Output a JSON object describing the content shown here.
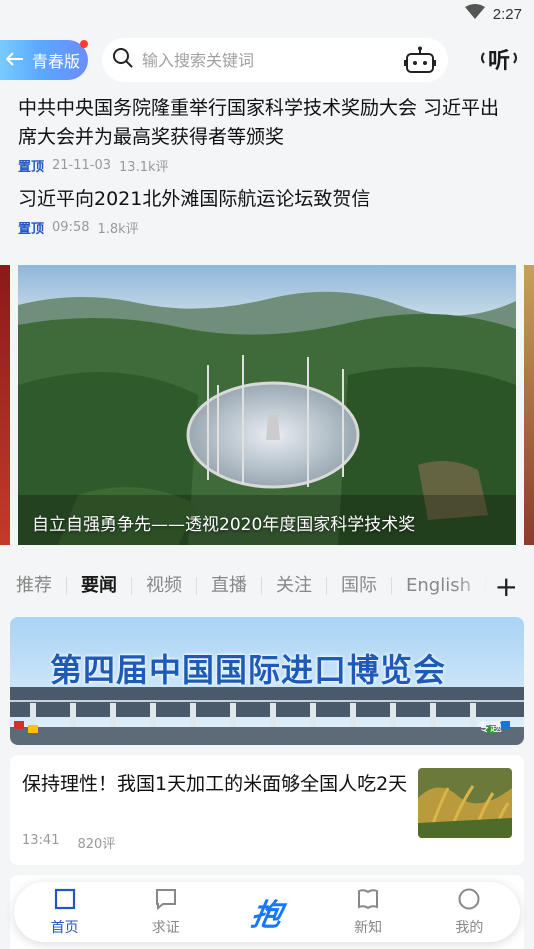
{
  "status_bar": {
    "time": "2:27"
  },
  "topbar": {
    "youth_label": "青春版",
    "search_placeholder": "输入搜索关键词",
    "listen_label": "听"
  },
  "headlines": [
    {
      "title": "中共中央国务院隆重举行国家科学技术奖励大会 习近平出席大会并为最高奖获得者等颁奖",
      "pin": "置顶",
      "date": "21-11-03",
      "comments": "13.1k评"
    },
    {
      "title": "习近平向2021北外滩国际航运论坛致贺信",
      "pin": "置顶",
      "date": "09:58",
      "comments": "1.8k评"
    }
  ],
  "carousel": {
    "caption": "自立自强勇争先——透视2020年度国家科学技术奖"
  },
  "tabs": [
    "推荐",
    "要闻",
    "视频",
    "直播",
    "关注",
    "国际",
    "English"
  ],
  "active_tab": "要闻",
  "banner": {
    "title": "第四届中国国际进口博览会",
    "tag": "专题"
  },
  "news": {
    "title": "保持理性！我国1天加工的米面够全国人吃2天",
    "time": "13:41",
    "comments": "820评"
  },
  "bottom_nav": {
    "home": "首页",
    "verify": "求证",
    "center": "抱",
    "newknow": "新知",
    "mine": "我的"
  },
  "colors": {
    "accent": "#2356c5",
    "brand_blue": "#1677ff"
  }
}
